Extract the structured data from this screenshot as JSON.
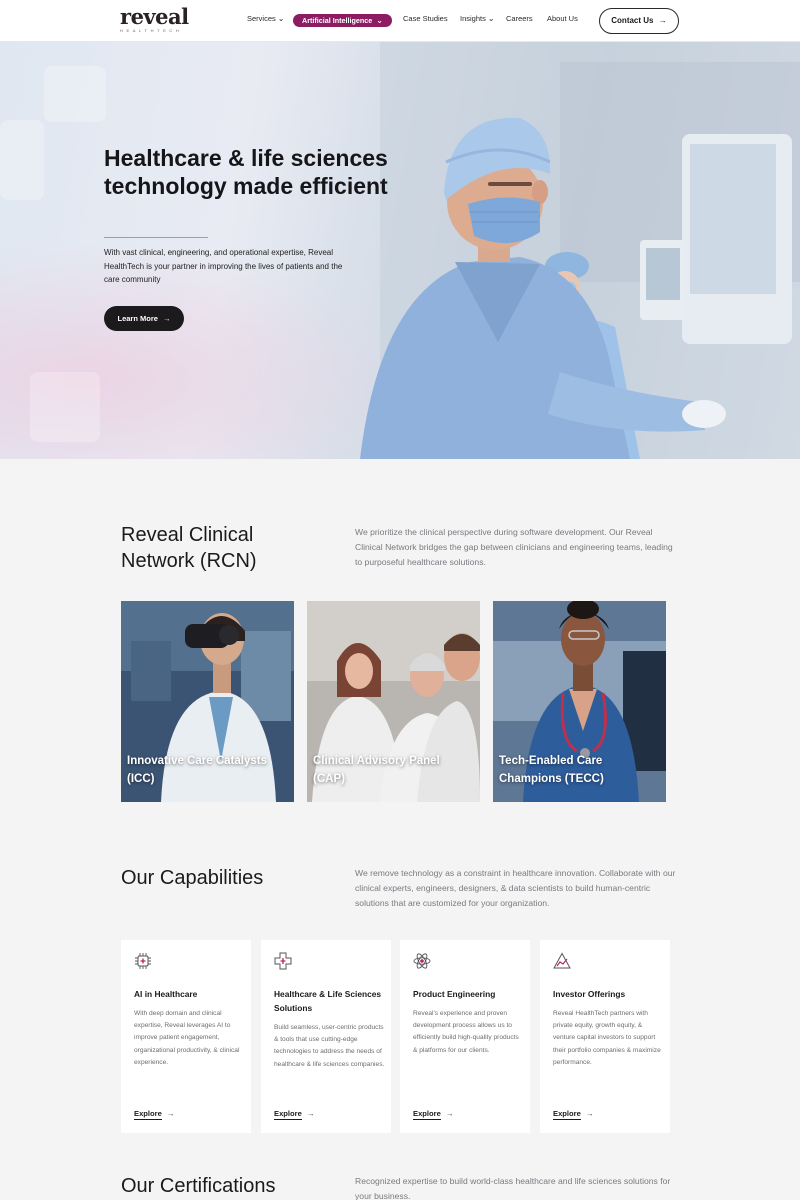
{
  "nav": {
    "logo_text": "reveal",
    "logo_subtext": "HEALTHTECH",
    "items": [
      {
        "label": "Services",
        "dropdown": true
      },
      {
        "label": "Artificial Intelligence",
        "dropdown": true,
        "highlighted": true
      },
      {
        "label": "Case Studies",
        "dropdown": false
      },
      {
        "label": "Insights",
        "dropdown": true
      },
      {
        "label": "Careers",
        "dropdown": false
      },
      {
        "label": "About Us",
        "dropdown": false
      }
    ],
    "contact_label": "Contact Us",
    "accent_color": "#8c1d63"
  },
  "hero": {
    "title": "Healthcare & life sciences technology made efficient",
    "description": "With vast clinical, engineering, and operational expertise, Reveal HealthTech is your partner in improving the lives of patients and the care community",
    "cta_label": "Learn More"
  },
  "rcn": {
    "title": "Reveal Clinical Network (RCN)",
    "description": "We prioritize the clinical perspective during software development. Our Reveal Clinical Network bridges the gap between clinicians and engineering teams, leading to purposeful healthcare solutions.",
    "cards": [
      {
        "label": "Innovative Care Catalysts (ICC)"
      },
      {
        "label": "Clinical Advisory Panel (CAP)"
      },
      {
        "label": "Tech-Enabled Care Champions (TECC)"
      }
    ]
  },
  "capabilities": {
    "title": "Our Capabilities",
    "description": "We remove technology as a constraint in healthcare innovation. Collaborate with our clinical experts, engineers, designers, & data scientists to build human-centric solutions that are customized for your organization.",
    "cards": [
      {
        "icon": "ai-chip-icon",
        "title": "AI in Healthcare",
        "description": "With deep domain and clinical expertise, Reveal leverages AI to improve patient engagement, organizational productivity, & clinical experience.",
        "link": "Explore"
      },
      {
        "icon": "medical-cross-icon",
        "title": "Healthcare & Life Sciences Solutions",
        "description": "Build seamless, user-centric products & tools that use cutting-edge technologies to address the needs of healthcare & life sciences companies.",
        "link": "Explore"
      },
      {
        "icon": "atom-icon",
        "title": "Product Engineering",
        "description": "Reveal's experience and proven development process allows us to efficiently build high-quality products & platforms for our clients.",
        "link": "Explore"
      },
      {
        "icon": "growth-triangle-icon",
        "title": "Investor Offerings",
        "description": "Reveal HealthTech partners with private equity, growth equity, & venture capital investors to support their portfolio companies & maximize performance.",
        "link": "Explore"
      }
    ]
  },
  "certifications": {
    "title": "Our Certifications",
    "description": "Recognized expertise to build world-class healthcare and life sciences solutions for your business."
  }
}
